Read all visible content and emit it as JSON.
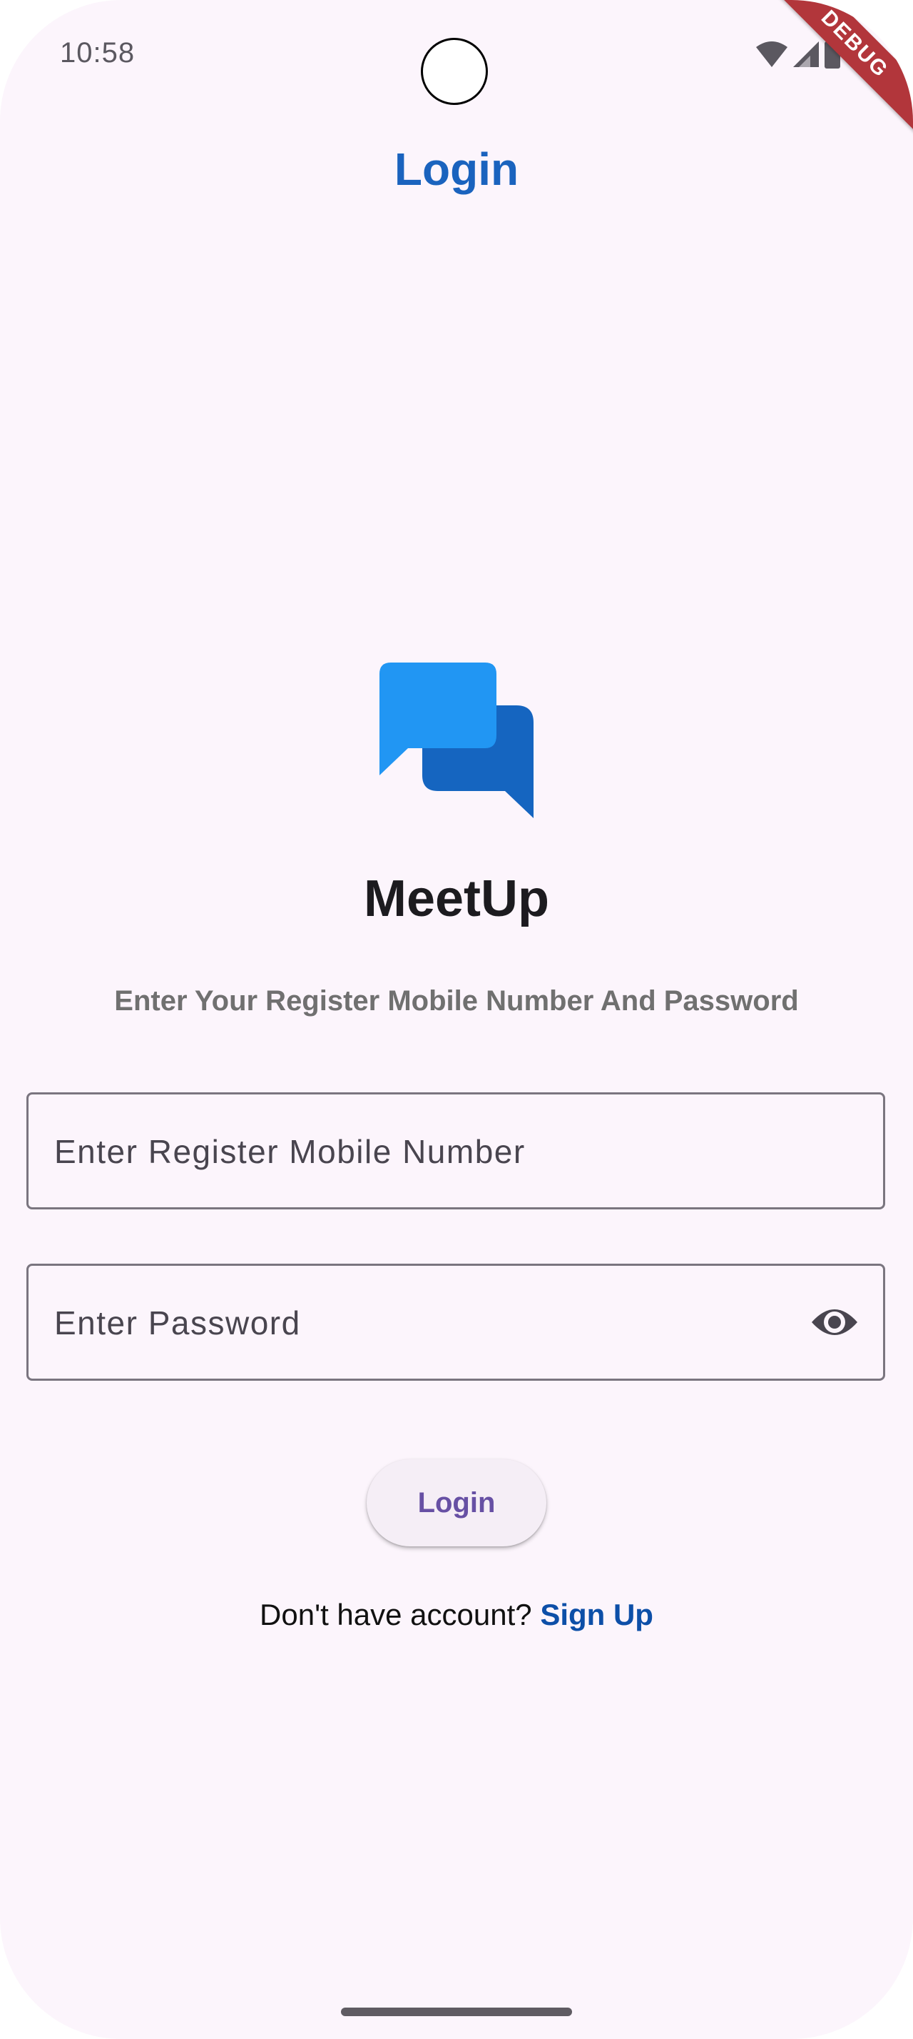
{
  "status_bar": {
    "time": "10:58",
    "icons": [
      "wifi-icon",
      "signal-icon",
      "battery-icon"
    ],
    "debug_label": "DEBUG"
  },
  "header": {
    "title": "Login"
  },
  "brand": {
    "logo_icon": "chat-bubbles-icon",
    "name": "MeetUp",
    "subtitle": "Enter Your Register Mobile Number And Password"
  },
  "form": {
    "phone_placeholder": "Enter Register Mobile Number",
    "phone_value": "",
    "password_placeholder": "Enter Password",
    "password_value": "",
    "visibility_icon": "eye-icon",
    "login_label": "Login"
  },
  "footer": {
    "prompt": "Don't have account?",
    "signup_label": "Sign Up"
  },
  "colors": {
    "primary": "#1a63be",
    "logo_light": "#2196f3",
    "logo_dark": "#1565c0",
    "button_text": "#6750a4",
    "background": "#fcf5fc",
    "debug_ribbon": "#b2363b"
  }
}
